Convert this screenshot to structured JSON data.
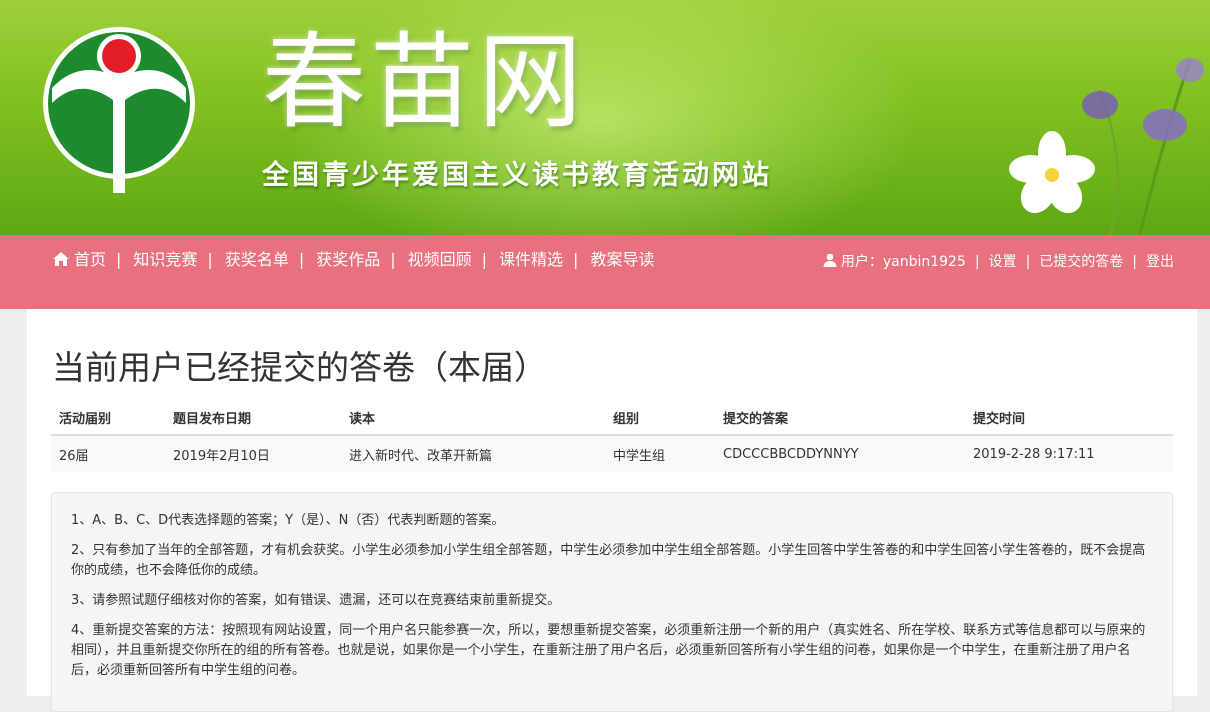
{
  "banner": {
    "title": "春苗网",
    "subtitle": "全国青少年爱国主义读书教育活动网站"
  },
  "nav": {
    "home_label": "首页",
    "items": [
      "知识竞赛",
      "获奖名单",
      "获奖作品",
      "视频回顾",
      "课件精选",
      "教案导读"
    ],
    "separator": "|",
    "user_label": "用户：yanbin1925",
    "settings_label": "设置",
    "submitted_label": "已提交的答卷",
    "logout_label": "登出"
  },
  "main": {
    "title": "当前用户已经提交的答卷（本届）",
    "table": {
      "headers": [
        "活动届别",
        "题目发布日期",
        "读本",
        "组别",
        "提交的答案",
        "提交时间"
      ],
      "rows": [
        [
          "26届",
          "2019年2月10日",
          "进入新时代、改革开新篇",
          "中学生组",
          "CDCCCBBCDDYNNYY",
          "2019-2-28 9:17:11"
        ]
      ]
    },
    "notes": [
      "1、A、B、C、D代表选择题的答案；Y（是）、N（否）代表判断题的答案。",
      "2、只有参加了当年的全部答题，才有机会获奖。小学生必须参加小学生组全部答题，中学生必须参加中学生组全部答题。小学生回答中学生答卷的和中学生回答小学生答卷的，既不会提高你的成绩，也不会降低你的成绩。",
      "3、请参照试题仔细核对你的答案，如有错误、遗漏，还可以在竞赛结束前重新提交。",
      "4、重新提交答案的方法：按照现有网站设置，同一个用户名只能参赛一次，所以，要想重新提交答案，必须重新注册一个新的用户（真实姓名、所在学校、联系方式等信息都可以与原来的相同），并且重新提交你所在的组的所有答卷。也就是说，如果你是一个小学生，在重新注册了用户名后，必须重新回答所有小学生组的问卷，如果你是一个中学生，在重新注册了用户名后，必须重新回答所有中学生组的问卷。"
    ]
  },
  "colors": {
    "banner_green": "#7fbf20",
    "nav_pink": "#e8707f",
    "logo_green": "#1e8a2e",
    "logo_red": "#e41e26"
  }
}
